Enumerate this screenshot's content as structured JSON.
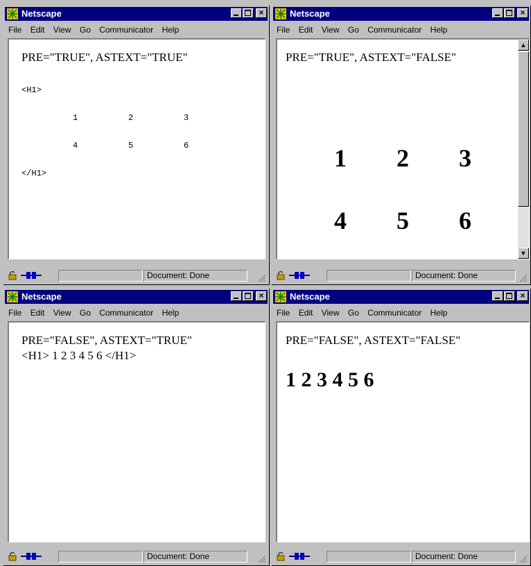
{
  "app": {
    "title": "Netscape"
  },
  "menu": [
    "File",
    "Edit",
    "View",
    "Go",
    "Communicator",
    "Help"
  ],
  "status": {
    "text": "Document: Done"
  },
  "windows": {
    "w1": {
      "heading": "PRE=\"TRUE\", ASTEXT=\"TRUE\"",
      "lines": {
        "open": "<H1>",
        "row1": [
          "1",
          "2",
          "3"
        ],
        "row2": [
          "4",
          "5",
          "6"
        ],
        "close": "</H1>"
      }
    },
    "w2": {
      "heading": "PRE=\"TRUE\", ASTEXT=\"FALSE\"",
      "row1": [
        "1",
        "2",
        "3"
      ],
      "row2": [
        "4",
        "5",
        "6"
      ]
    },
    "w3": {
      "heading": "PRE=\"FALSE\", ASTEXT=\"TRUE\"",
      "line": "<H1> 1 2 3 4 5 6 </H1>"
    },
    "w4": {
      "heading": "PRE=\"FALSE\", ASTEXT=\"FALSE\"",
      "big": "1 2 3 4 5 6"
    }
  },
  "icons": {
    "title": "netscape-logo-icon",
    "lock": "security-lock-icon",
    "component": "component-bar-icon",
    "grip": "resize-grip-icon"
  }
}
